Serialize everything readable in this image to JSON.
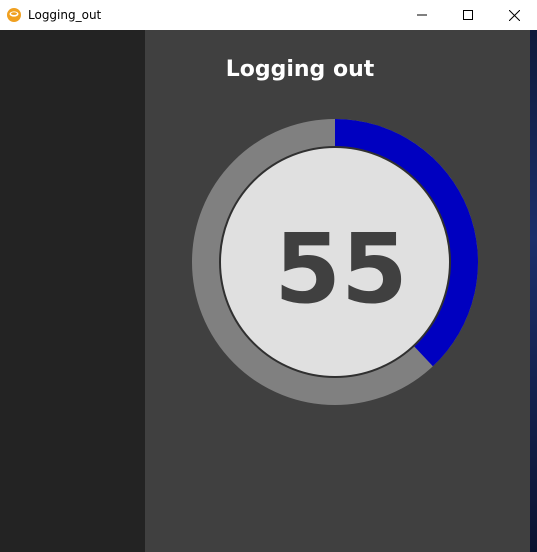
{
  "window": {
    "title": "Logging_out",
    "icon": "app-logo-icon",
    "controls": {
      "minimize_icon": "minimize-icon",
      "maximize_icon": "maximize-icon",
      "close_icon": "close-icon"
    }
  },
  "main": {
    "title": "Logging out",
    "countdown": {
      "value": "55",
      "progress_fraction": 0.38
    }
  },
  "colors": {
    "sidebar": "#232323",
    "main_background": "#404040",
    "ring_track": "#808080",
    "ring_progress": "#0000c0",
    "inner_circle": "#e0e0e0",
    "number": "#404040"
  }
}
